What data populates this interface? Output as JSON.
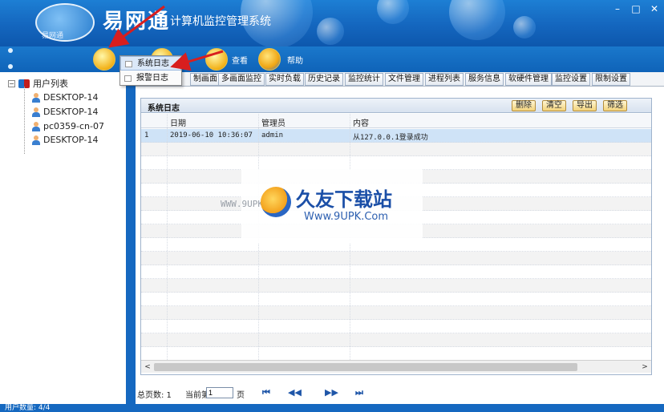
{
  "app": {
    "brand": "易网通",
    "logo_sub": "易网通",
    "title": "计算机监控管理系统"
  },
  "window_controls": {
    "minimize": "–",
    "maximize": "□",
    "close": "✕"
  },
  "toolbar": {
    "items": [
      {
        "icon": "log-book-icon",
        "label": ""
      },
      {
        "icon": "settings-icon",
        "label": ""
      },
      {
        "icon": "view-icon",
        "label": "查看"
      },
      {
        "icon": "help-icon",
        "label": "帮助"
      }
    ]
  },
  "dropdown": {
    "items": [
      {
        "label": "系统日志",
        "highlighted": true
      },
      {
        "label": "报警日志",
        "highlighted": false
      }
    ]
  },
  "sidebar": {
    "root_label": "用户列表",
    "toggle": "−",
    "items": [
      "DESKTOP-14",
      "DESKTOP-14",
      "pc0359-cn-07",
      "DESKTOP-14"
    ]
  },
  "tabs": [
    "制画面",
    "多画面监控",
    "实时负载",
    "历史记录",
    "监控统计",
    "文件管理",
    "进程列表",
    "服务信息",
    "软硬件管理",
    "监控设置",
    "限制设置"
  ],
  "panel": {
    "title": "系统日志",
    "buttons": [
      "删除",
      "清空",
      "导出",
      "筛选"
    ]
  },
  "table": {
    "columns": [
      "日期",
      "管理员",
      "内容"
    ],
    "rows": [
      {
        "index": "1",
        "date": "2019-06-10 10:36:07",
        "admin": "admin",
        "content": "从127.0.0.1登录成功"
      }
    ]
  },
  "scrollbar": {
    "left": "<",
    "right": ">"
  },
  "pager": {
    "total_label": "总页数: 1",
    "current_label": "当前第",
    "current_value": "1",
    "page_suffix": "页",
    "first": "⏮",
    "prev": "◀◀",
    "next": "▶▶",
    "last": "⏭"
  },
  "status": {
    "text": "用户数量: 4/4"
  },
  "watermark": {
    "left": "WWW.9UPK.COM",
    "main": "久友下载站",
    "url": "Www.9UPK.Com"
  },
  "colors": {
    "header": "#1568c0",
    "accent": "#c8102e",
    "selected_row": "#cfe3f7"
  }
}
